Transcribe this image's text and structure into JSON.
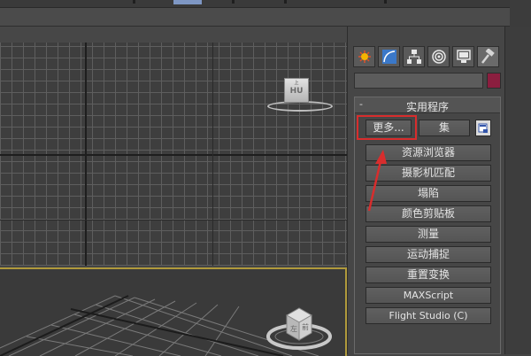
{
  "panel": {
    "tabs": [
      {
        "name": "create-tab",
        "icon": "star-icon"
      },
      {
        "name": "modify-tab",
        "icon": "curve-icon"
      },
      {
        "name": "hierarchy-tab",
        "icon": "hierarchy-icon"
      },
      {
        "name": "motion-tab",
        "icon": "motion-icon"
      },
      {
        "name": "display-tab",
        "icon": "monitor-icon"
      },
      {
        "name": "utilities-tab",
        "icon": "hammer-icon"
      }
    ],
    "name_field_value": "",
    "swatch_color": "#8b1e3f",
    "rollout": {
      "toggle": "-",
      "title": "实用程序",
      "more_label": "更多...",
      "set_label": "集",
      "buttons": [
        "资源浏览器",
        "摄影机匹配",
        "塌陷",
        "颜色剪贴板",
        "测量",
        "运动捕捉",
        "重置变换",
        "MAXScript",
        "Flight Studio (C)"
      ]
    }
  },
  "viewcube": {
    "top_face": "上",
    "front_face": "前",
    "left_face": "左",
    "top_view_label": "HU"
  },
  "colors": {
    "highlight": "#d82d2d",
    "active_viewport_border": "#b09a3c"
  }
}
